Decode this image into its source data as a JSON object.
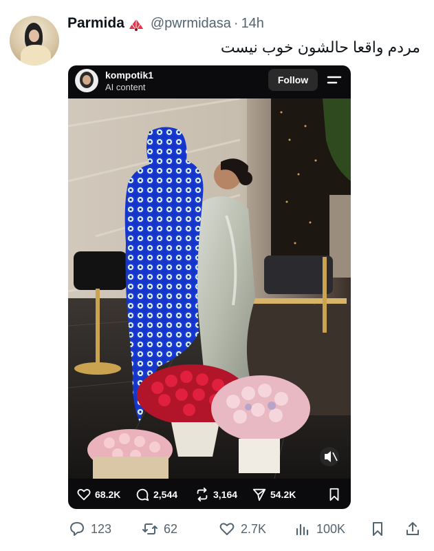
{
  "tweet": {
    "author_name": "Parmida",
    "author_badge_icon": "fan-icon",
    "handle": "@pwrmidasa",
    "separator": "·",
    "time": "14h",
    "text": "مردم واقعا حالشون خوب نیست"
  },
  "embedded_post": {
    "username": "kompotik1",
    "subtitle": "AI content",
    "follow_label": "Follow",
    "menu_icon": "menu-icon",
    "mute_icon": "mute-icon",
    "stats": {
      "likes": "68.2K",
      "comments": "2,544",
      "reposts": "3,164",
      "shares": "54.2K"
    }
  },
  "actions": {
    "replies": "123",
    "retweets": "62",
    "likes": "2.7K",
    "views": "100K"
  },
  "colors": {
    "secondary_text": "#536471",
    "card_bg": "#0b0b0d",
    "evil_eye_blue": "#1535c9"
  }
}
